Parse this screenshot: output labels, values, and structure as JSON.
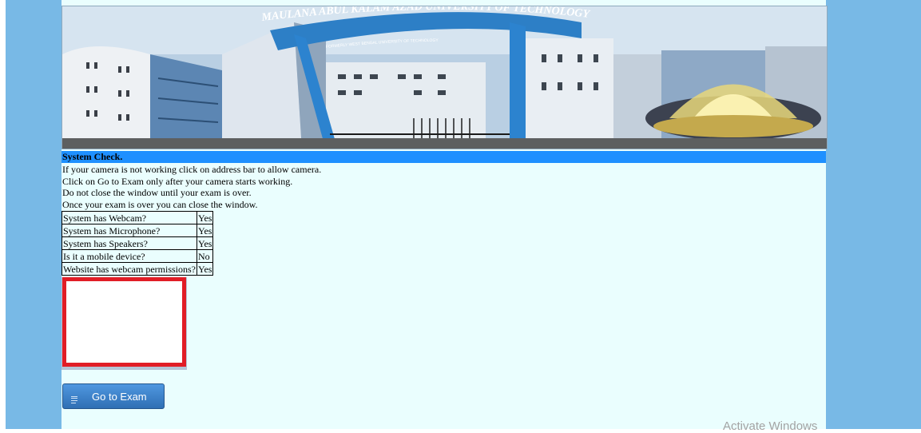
{
  "banner": {
    "institution_name": "MAULANA ABUL KALAM AZAD UNIVERSITY OF TECHNOLOGY",
    "institution_sub": "FORMERLY WEST BENGAL UNIVERSITY OF TECHNOLOGY"
  },
  "system_check": {
    "heading": "System Check.",
    "instructions": [
      "If your camera is not working click on address bar to allow camera.",
      "Click on Go to Exam only after your camera starts working.",
      "Do not close the window until your exam is over.",
      "Once your exam is over you can close the window."
    ],
    "rows": [
      {
        "label": "System has Webcam?",
        "value": "Yes"
      },
      {
        "label": "System has Microphone?",
        "value": "Yes"
      },
      {
        "label": "System has Speakers?",
        "value": "Yes"
      },
      {
        "label": "Is it a mobile device?",
        "value": "No"
      },
      {
        "label": "Website has webcam permissions?",
        "value": "Yes"
      }
    ]
  },
  "actions": {
    "go_to_exam_label": "Go to Exam",
    "go_to_exam_icon": "menu-lines-icon"
  },
  "os": {
    "watermark": "Activate Windows"
  },
  "colors": {
    "outer_background": "#78b9e6",
    "page_background": "#eafefe",
    "section_bar": "#1e90ff",
    "camera_frame": "#e11d26",
    "button": "#3a80c9"
  }
}
